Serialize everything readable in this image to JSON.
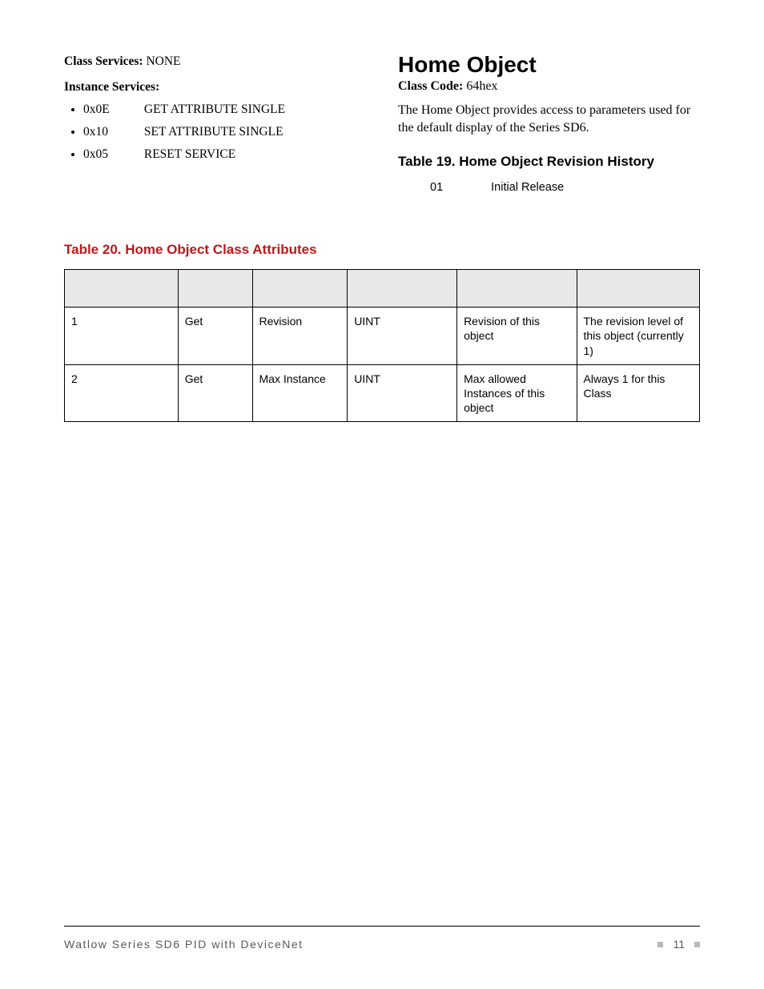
{
  "left": {
    "class_services_label": "Class Services:",
    "class_services_value": "NONE",
    "instance_services_label": "Instance Services:",
    "services": [
      {
        "code": "0x0E",
        "name": "GET ATTRIBUTE SINGLE"
      },
      {
        "code": "0x10",
        "name": "SET ATTRIBUTE SINGLE"
      },
      {
        "code": "0x05",
        "name": "RESET SERVICE"
      }
    ]
  },
  "right": {
    "heading": "Home Object",
    "class_code_label": "Class Code:",
    "class_code_value": "64hex",
    "description": "The Home Object provides access to parameters used for the default display of the Series SD6.",
    "table19_title": "Table 19. Home Object Revision History",
    "rev_num": "01",
    "rev_text": "Initial Release"
  },
  "table20": {
    "title": "Table 20. Home Object Class Attributes",
    "headers": [
      "",
      "",
      "",
      "",
      "",
      ""
    ],
    "rows": [
      {
        "id": "1",
        "access": "Get",
        "name": "Revision",
        "type": "UINT",
        "desc": "Revision of this object",
        "sem": "The revision level of this object (currently 1)"
      },
      {
        "id": "2",
        "access": "Get",
        "name": "Max Instance",
        "type": "UINT",
        "desc": "Max allowed Instances of this object",
        "sem": "Always 1 for this Class"
      }
    ]
  },
  "footer": {
    "left": "Watlow Series SD6 PID with DeviceNet",
    "page": "11"
  }
}
